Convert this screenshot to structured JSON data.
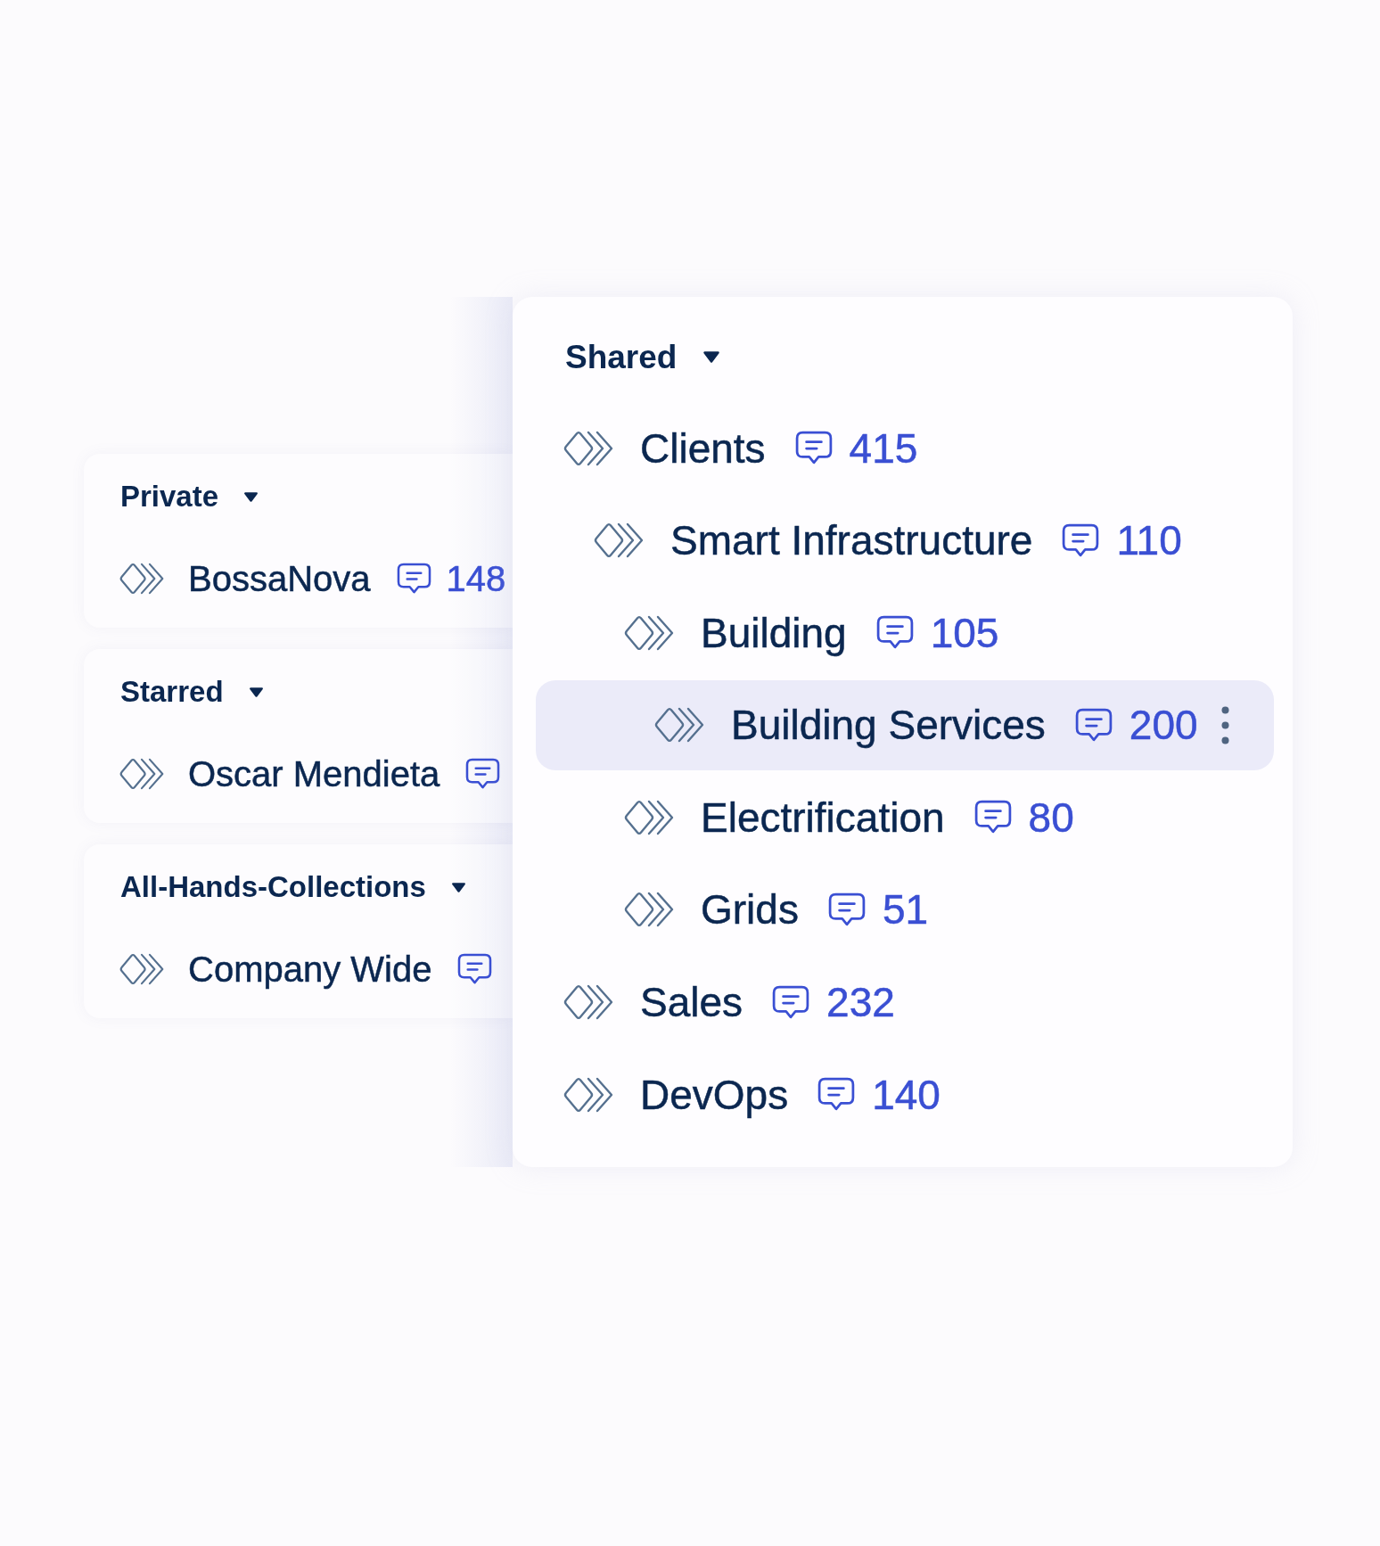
{
  "sidebar": {
    "sections": [
      {
        "title": "Private",
        "expanded": true,
        "items": [
          {
            "name": "BossaNova",
            "count": "148",
            "selected": false
          }
        ]
      },
      {
        "title": "Starred",
        "expanded": true,
        "items": [
          {
            "name": "Oscar Mendieta",
            "selected": false
          }
        ]
      },
      {
        "title": "All-Hands-Collections",
        "expanded": true,
        "items": [
          {
            "name": "Company Wide",
            "selected": false
          }
        ]
      }
    ]
  },
  "shared_tree": {
    "title": "Shared",
    "expanded": true,
    "items": [
      {
        "name": "Clients",
        "count": "415",
        "selected": false,
        "children": [
          {
            "name": "Smart Infrastructure",
            "count": "110",
            "selected": false,
            "children": [
              {
                "name": "Building",
                "count": "105",
                "selected": false,
                "children": [
                  {
                    "name": "Building Services",
                    "count": "200",
                    "selected": true
                  }
                ]
              },
              {
                "name": "Electrification",
                "count": "80",
                "selected": false
              },
              {
                "name": "Grids",
                "count": "51",
                "selected": false
              }
            ]
          }
        ]
      },
      {
        "name": "Sales",
        "count": "232",
        "selected": false
      },
      {
        "name": "DevOps",
        "count": "140",
        "selected": false
      }
    ]
  }
}
